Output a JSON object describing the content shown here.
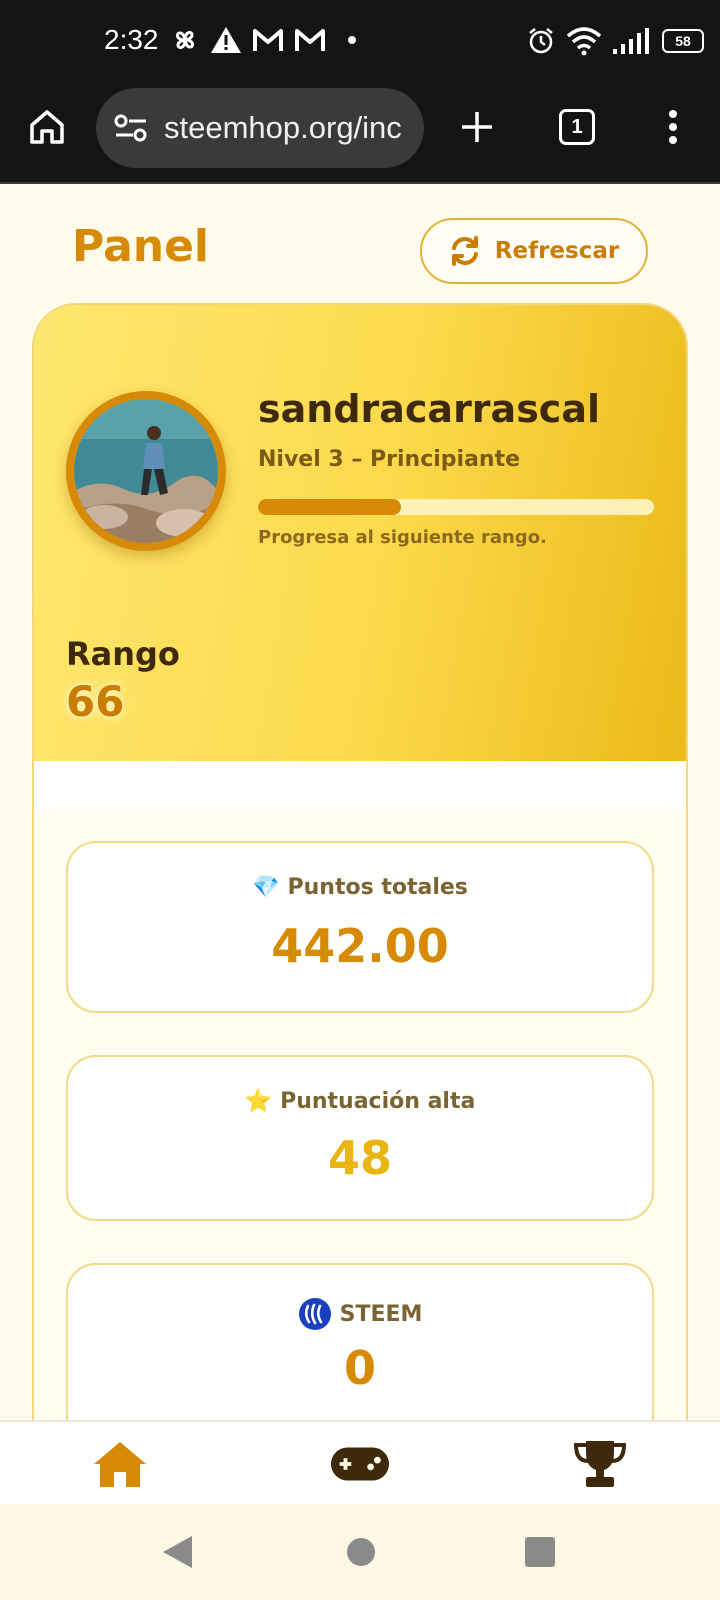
{
  "status_bar": {
    "time": "2:32",
    "battery": "58",
    "icons_left": [
      "pinwheel-icon",
      "warning-icon",
      "gmail-icon",
      "gmail-icon",
      "dot-icon"
    ],
    "icons_right": [
      "alarm-icon",
      "wifi-icon",
      "signal-icon",
      "battery-icon"
    ]
  },
  "browser": {
    "url": "steemhop.org/inc",
    "tab_count": "1"
  },
  "header": {
    "title": "Panel",
    "refresh_label": "Refrescar"
  },
  "profile": {
    "username": "sandracarrascal",
    "level": "Nivel 3 – Principiante",
    "progress_fraction": 0.36,
    "progress_text": "Progresa al siguiente rango.",
    "rank_label": "Rango",
    "rank_value": "66"
  },
  "stats": [
    {
      "icon": "💎",
      "label": "Puntos totales",
      "value": "442.00",
      "color": "#d68a05"
    },
    {
      "icon": "⭐",
      "label": "Puntuación alta",
      "value": "48",
      "color": "#e8b512"
    },
    {
      "icon": "steem-logo-icon",
      "label": "STEEM",
      "value": "0",
      "color": "#d68a05"
    }
  ],
  "bottom_nav": [
    "home-icon",
    "gamepad-icon",
    "trophy-icon"
  ],
  "colors": {
    "accent": "#d68a05",
    "accent_dark": "#3e2a0a",
    "hero_start": "#fee770",
    "hero_end": "#eab919"
  }
}
